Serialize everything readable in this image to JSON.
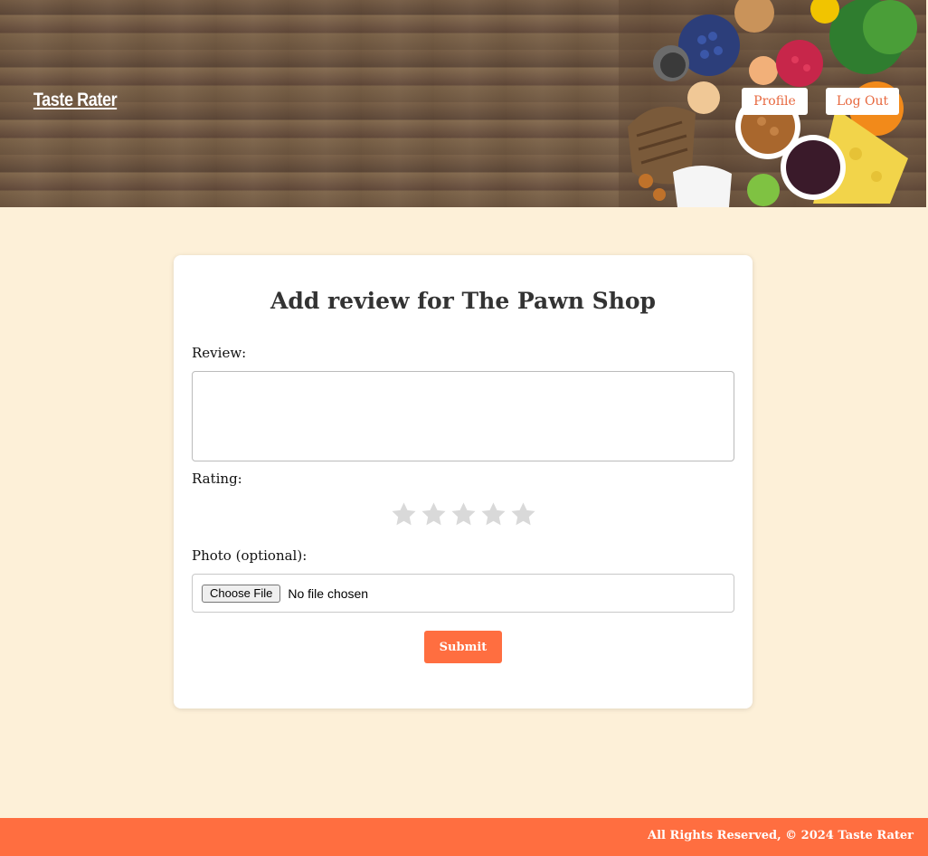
{
  "header": {
    "logo": "Taste Rater",
    "nav": {
      "profile": "Profile",
      "logout": "Log Out"
    }
  },
  "form": {
    "title": "Add review for The Pawn Shop",
    "review_label": "Review:",
    "review_value": "",
    "rating_label": "Rating:",
    "rating_value": 0,
    "rating_max": 5,
    "photo_label": "Photo (optional):",
    "file_button": "Choose File",
    "file_status": "No file chosen",
    "submit": "Submit"
  },
  "footer": {
    "text": "All Rights Reserved, © 2024 Taste Rater"
  },
  "colors": {
    "accent": "#ff6e40",
    "nav_text": "#e7683f",
    "page_bg": "#fdf0d8",
    "star_empty": "#d9d9d9"
  }
}
